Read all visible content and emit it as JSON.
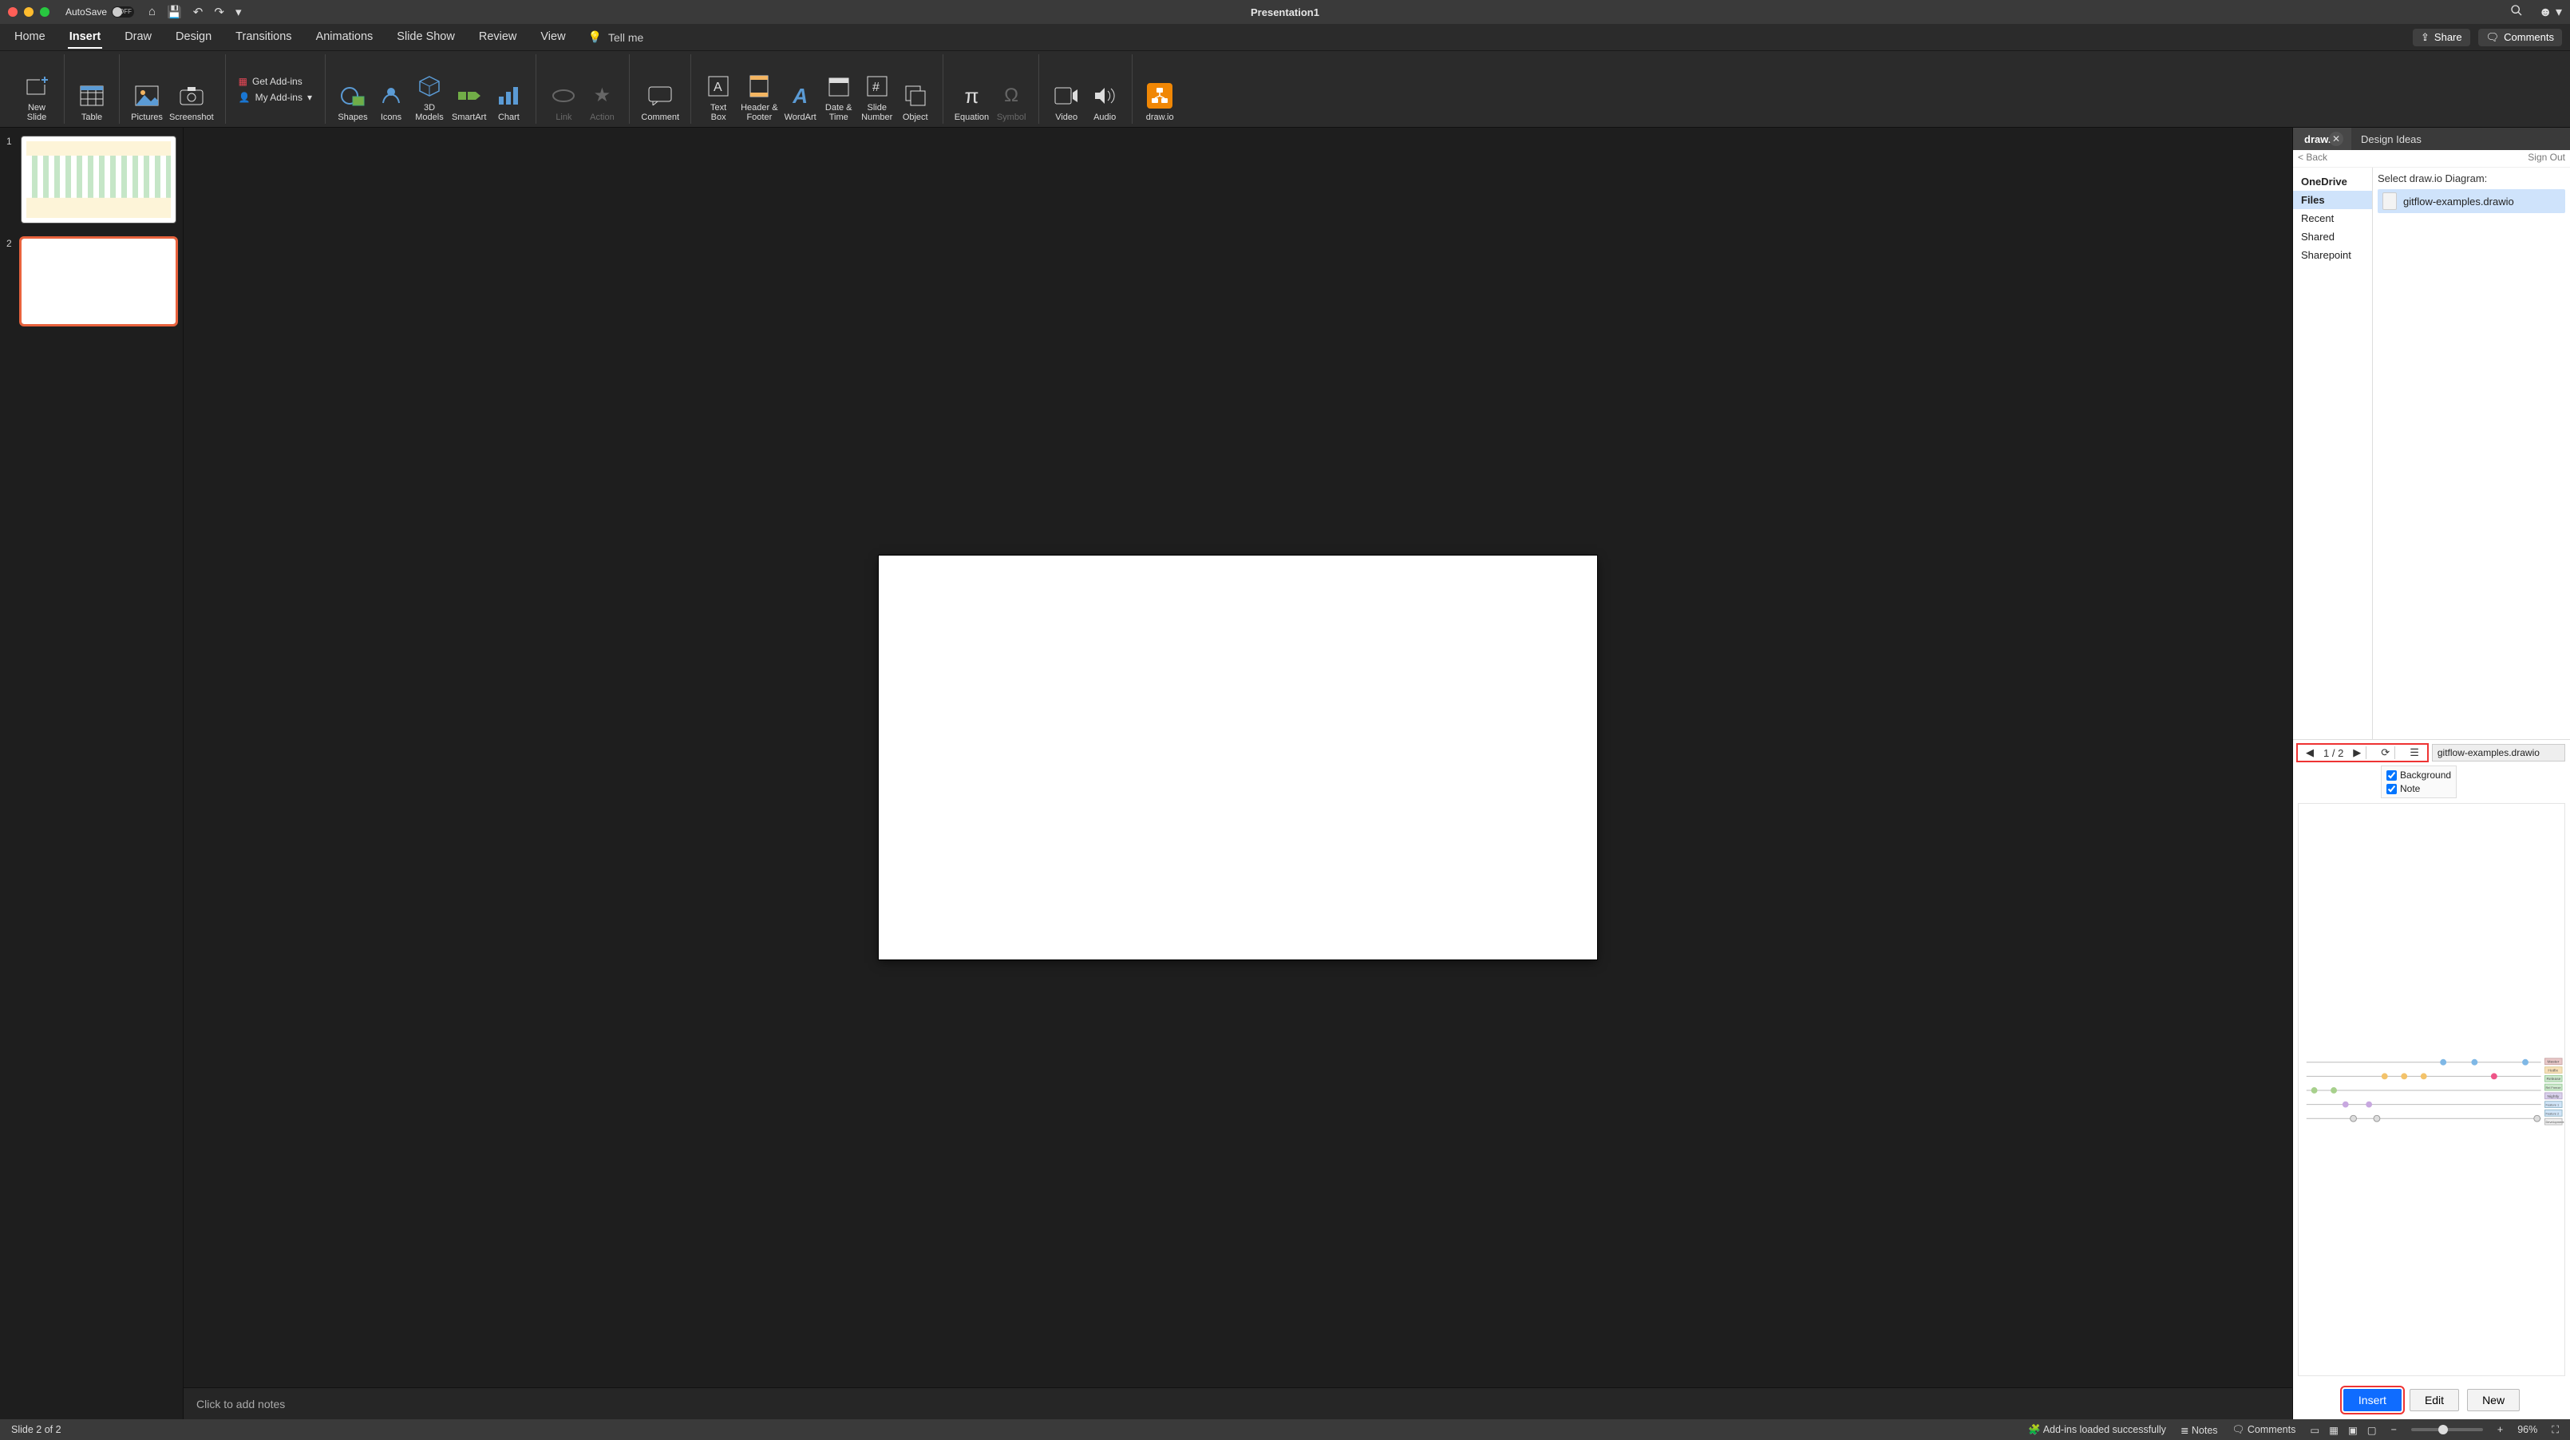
{
  "titlebar": {
    "autosave_label": "AutoSave",
    "autosave_state": "OFF",
    "title": "Presentation1"
  },
  "tabs": {
    "home": "Home",
    "insert": "Insert",
    "draw": "Draw",
    "design": "Design",
    "transitions": "Transitions",
    "animations": "Animations",
    "slideshow": "Slide Show",
    "review": "Review",
    "view": "View",
    "tellme": "Tell me",
    "share": "Share",
    "comments": "Comments"
  },
  "ribbon": {
    "new_slide": "New\nSlide",
    "table": "Table",
    "pictures": "Pictures",
    "screenshot": "Screenshot",
    "get_addins": "Get Add-ins",
    "my_addins": "My Add-ins",
    "shapes": "Shapes",
    "icons": "Icons",
    "models": "3D\nModels",
    "smartart": "SmartArt",
    "chart": "Chart",
    "link": "Link",
    "action": "Action",
    "comment": "Comment",
    "textbox": "Text\nBox",
    "headerfooter": "Header &\nFooter",
    "wordart": "WordArt",
    "datetime": "Date &\nTime",
    "slidenumber": "Slide\nNumber",
    "object": "Object",
    "equation": "Equation",
    "symbol": "Symbol",
    "video": "Video",
    "audio": "Audio",
    "drawio": "draw.io"
  },
  "thumbs": {
    "s1": "1",
    "s2": "2"
  },
  "notes_placeholder": "Click to add notes",
  "rightpane": {
    "tab_drawio": "draw.io",
    "tab_design": "Design Ideas",
    "back": "< Back",
    "signout": "Sign Out",
    "nav": {
      "onedrive": "OneDrive",
      "files": "Files",
      "recent": "Recent",
      "shared": "Shared",
      "sharepoint": "Sharepoint"
    },
    "select_label": "Select draw.io Diagram:",
    "file_name": "gitflow-examples.drawio",
    "pager": "1 / 2",
    "background": "Background",
    "note": "Note",
    "insert": "Insert",
    "edit": "Edit",
    "new": "New"
  },
  "status": {
    "slide": "Slide 2 of 2",
    "addins": "Add-ins loaded successfully",
    "notes": "Notes",
    "comments": "Comments",
    "zoom": "96%"
  }
}
